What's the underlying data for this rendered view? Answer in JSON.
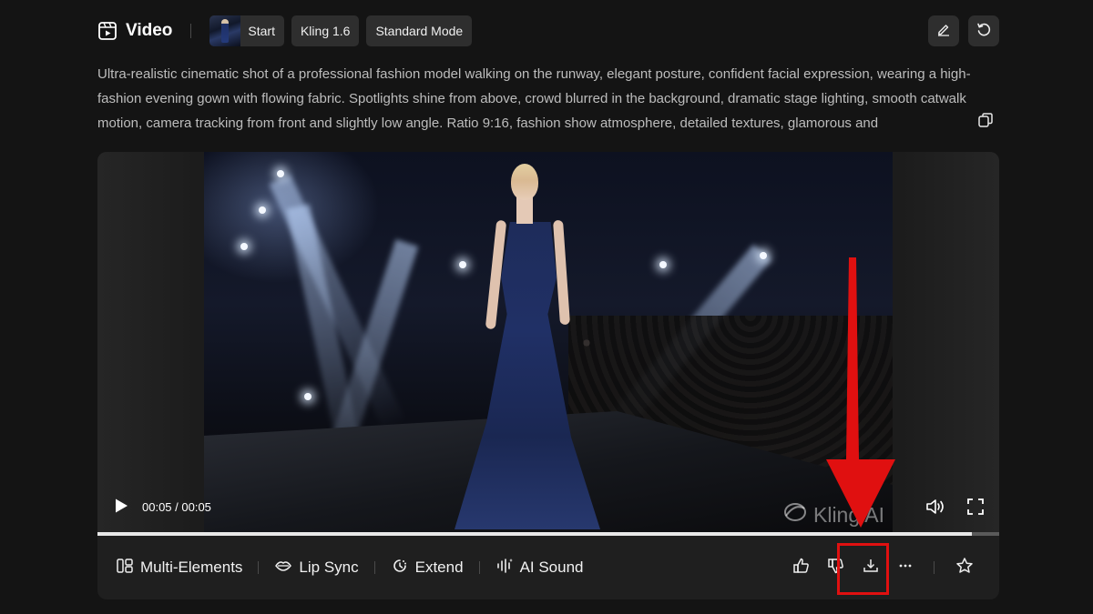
{
  "header": {
    "title": "Video",
    "chips": [
      "Start",
      "Kling 1.6",
      "Standard Mode"
    ],
    "icons": [
      "video-icon",
      "edit-icon",
      "regenerate-icon"
    ]
  },
  "prompt": {
    "text": "Ultra-realistic cinematic shot of a professional fashion model walking on the runway, elegant posture, confident facial expression, wearing a high-fashion evening gown with flowing fabric. Spotlights shine from above, crowd blurred in the background, dramatic stage lighting, smooth catwalk motion, camera tracking from front and slightly low angle. Ratio 9:16, fashion show atmosphere, detailed textures, glamorous and"
  },
  "player": {
    "time": "00:05 / 00:05",
    "watermark": "Kling AI",
    "progress": 0.97
  },
  "actions": {
    "items": [
      {
        "label": "Multi-Elements",
        "icon": "multi-elements-icon"
      },
      {
        "label": "Lip Sync",
        "icon": "lip-sync-icon"
      },
      {
        "label": "Extend",
        "icon": "extend-icon"
      },
      {
        "label": "AI Sound",
        "icon": "ai-sound-icon"
      }
    ],
    "right_icons": [
      "thumbs-up-icon",
      "thumbs-down-icon",
      "download-icon",
      "more-icon",
      "star-icon"
    ]
  },
  "annotation": {
    "color": "#e01010"
  }
}
